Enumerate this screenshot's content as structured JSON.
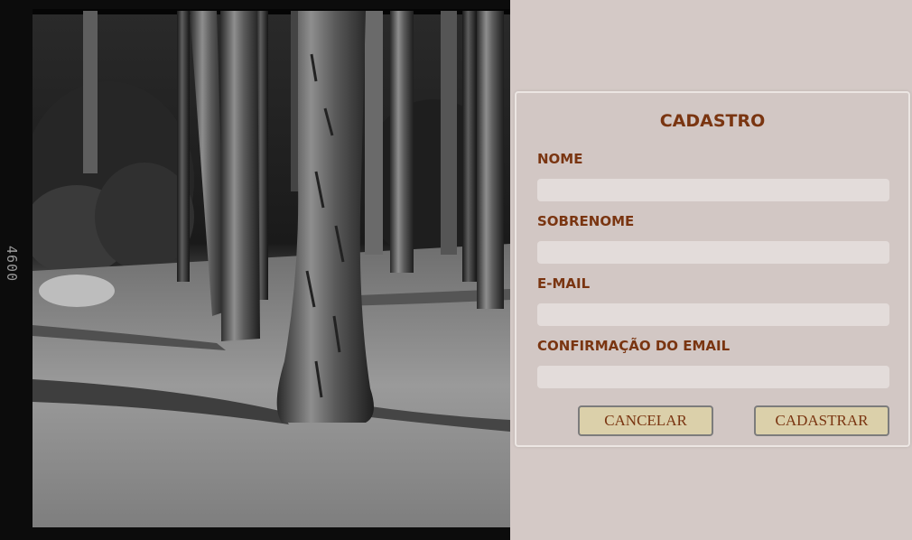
{
  "photo": {
    "film_number": "4600",
    "description_icon": "forest-photo"
  },
  "form": {
    "title": "CADASTRO",
    "fields": [
      {
        "label": "NOME",
        "value": "",
        "placeholder": ""
      },
      {
        "label": "SOBRENOME",
        "value": "",
        "placeholder": ""
      },
      {
        "label": "E-MAIL",
        "value": "",
        "placeholder": ""
      },
      {
        "label": "CONFIRMAÇÃO DO EMAIL",
        "value": "",
        "placeholder": ""
      }
    ],
    "cancel_label": "CANCELAR",
    "submit_label": "CADASTRAR"
  },
  "colors": {
    "background": "#d4c9c6",
    "accent_text": "#7a3511",
    "input_bg": "#e3dcda",
    "button_bg": "#dbd0aa"
  }
}
